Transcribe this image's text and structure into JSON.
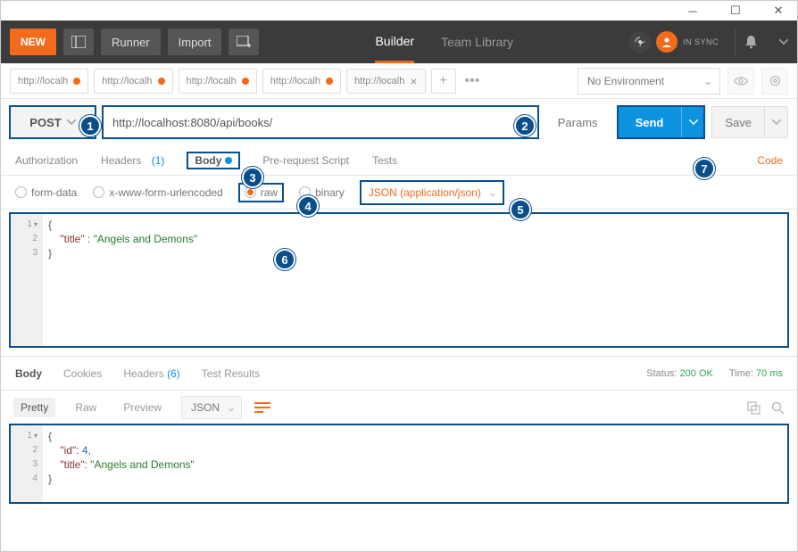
{
  "window": {
    "title": ""
  },
  "topbar": {
    "new_label": "NEW",
    "runner_label": "Runner",
    "import_label": "Import",
    "builder_tab": "Builder",
    "team_tab": "Team Library",
    "sync_label": "IN SYNC"
  },
  "tabs": {
    "items": [
      {
        "label": "http://localh",
        "dirty": true,
        "active": false
      },
      {
        "label": "http://localh",
        "dirty": true,
        "active": false
      },
      {
        "label": "http://localh",
        "dirty": true,
        "active": false
      },
      {
        "label": "http://localh",
        "dirty": true,
        "active": false
      },
      {
        "label": "http://localh",
        "dirty": false,
        "active": true
      }
    ]
  },
  "environment": {
    "selected": "No Environment"
  },
  "request": {
    "method": "POST",
    "url": "http://localhost:8080/api/books/",
    "params_label": "Params",
    "send_label": "Send",
    "save_label": "Save",
    "subtabs": {
      "authorization": "Authorization",
      "headers": "Headers",
      "headers_count": "(1)",
      "body": "Body",
      "prerequest": "Pre-request Script",
      "tests": "Tests",
      "code_link": "Code"
    },
    "body_types": {
      "form_data": "form-data",
      "urlencoded": "x-www-form-urlencoded",
      "raw": "raw",
      "binary": "binary",
      "content_type": "JSON (application/json)"
    },
    "body_code": {
      "lines": [
        "{",
        "    \"title\" : \"Angels and Demons\"",
        "}"
      ],
      "key1": "\"title\"",
      "val1": "\"Angels and Demons\""
    }
  },
  "response": {
    "tabs": {
      "body": "Body",
      "cookies": "Cookies",
      "headers": "Headers",
      "headers_count": "(6)",
      "test_results": "Test Results"
    },
    "status_label": "Status:",
    "status_value": "200 OK",
    "time_label": "Time:",
    "time_value": "70 ms",
    "modes": {
      "pretty": "Pretty",
      "raw": "Raw",
      "preview": "Preview",
      "format": "JSON"
    },
    "body_code": {
      "key1": "\"id\"",
      "val1": "4",
      "key2": "\"title\"",
      "val2": "\"Angels and Demons\""
    }
  },
  "callouts": {
    "c1": "1",
    "c2": "2",
    "c3": "3",
    "c4": "4",
    "c5": "5",
    "c6": "6",
    "c7": "7"
  }
}
